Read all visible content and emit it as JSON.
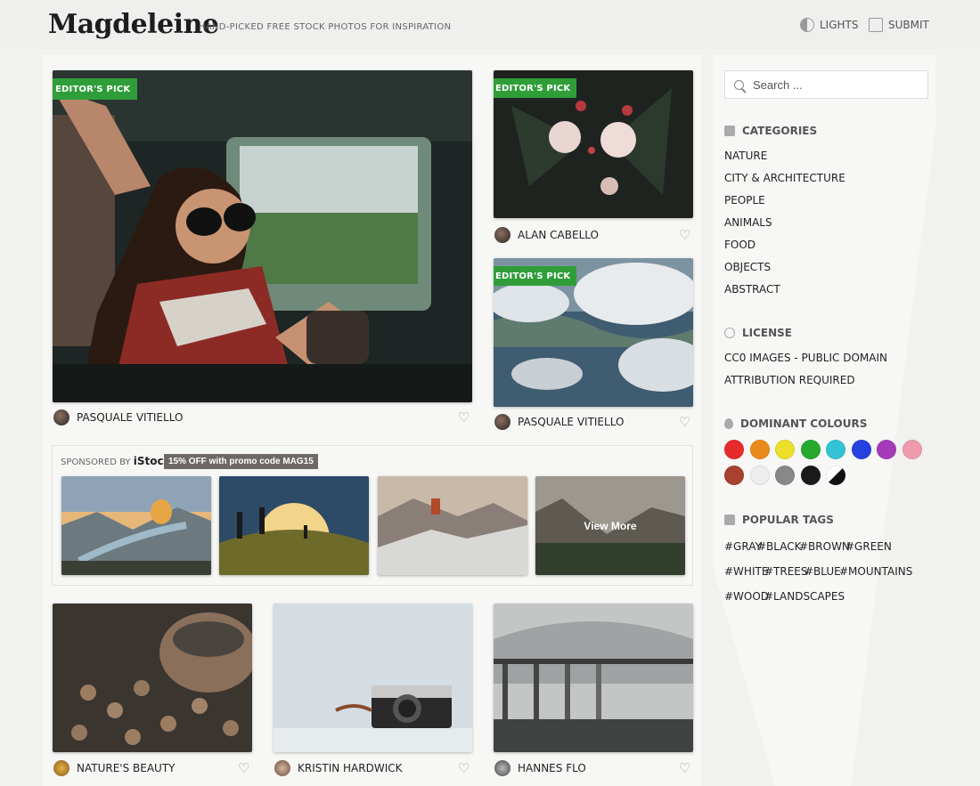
{
  "header": {
    "logo": "Magdeleine",
    "tagline": "HAND-PICKED FREE STOCK PHOTOS FOR INSPIRATION",
    "lights_label": "LIGHTS",
    "submit_label": "SUBMIT"
  },
  "photos": [
    {
      "badge": "EDITOR'S PICK",
      "author": "PASQUALE VITIELLO"
    },
    {
      "badge": "EDITOR'S PICK",
      "author": "ALAN CABELLO"
    },
    {
      "badge": "EDITOR'S PICK",
      "author": "PASQUALE VITIELLO"
    },
    {
      "author": "NATURE'S BEAUTY"
    },
    {
      "author": "KRISTIN HARDWICK"
    },
    {
      "author": "HANNES FLO"
    }
  ],
  "sponsored": {
    "label": "SPONSORED BY",
    "brand": "iStock",
    "promo": "15% OFF with promo code MAG15",
    "view_more": "View More"
  },
  "sidebar": {
    "search_placeholder": "Search ...",
    "categories_title": "CATEGORIES",
    "categories": [
      "NATURE",
      "CITY & ARCHITECTURE",
      "PEOPLE",
      "ANIMALS",
      "FOOD",
      "OBJECTS",
      "ABSTRACT"
    ],
    "license_title": "LICENSE",
    "licenses": [
      "CC0 IMAGES - PUBLIC DOMAIN",
      "ATTRIBUTION REQUIRED"
    ],
    "colours_title": "DOMINANT COLOURS",
    "colours": [
      "#e52b2b",
      "#ea8a1c",
      "#ecdf29",
      "#27a82e",
      "#33c4d4",
      "#2641e0",
      "#a33bb8",
      "#ef9cae",
      "#a8412f",
      "#eeeeee",
      "#888888",
      "#1a1a1a",
      "bw"
    ],
    "tags_title": "POPULAR TAGS",
    "tags": [
      [
        "#GRAY",
        "#BLACK",
        "#BROWN",
        "#GREEN"
      ],
      [
        "#WHITE",
        "#TREES",
        "#BLUE",
        "#MOUNTAINS"
      ],
      [
        "#WOOD",
        "#LANDSCAPES"
      ]
    ]
  }
}
